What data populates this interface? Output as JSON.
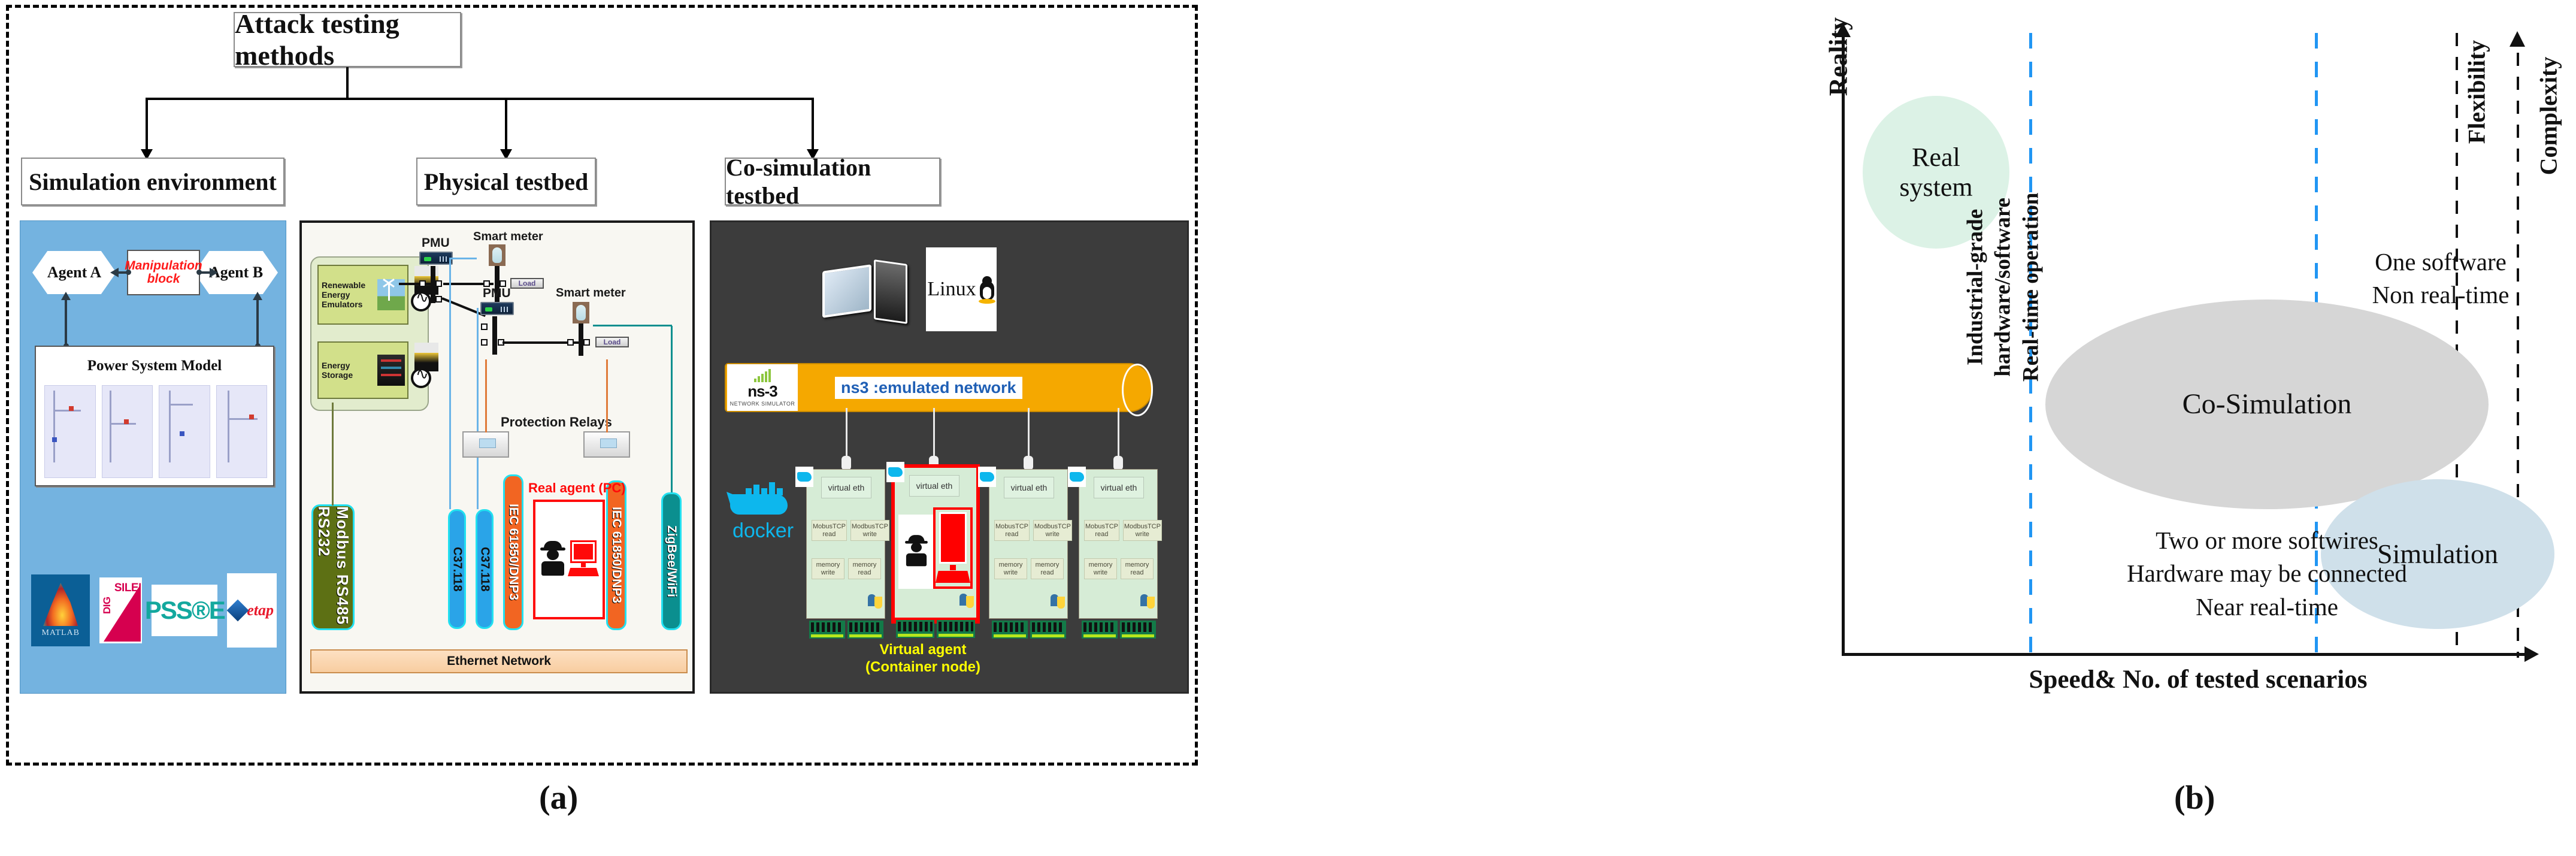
{
  "figure": {
    "caption_a": "(a)",
    "caption_b": "(b)"
  },
  "flowchart": {
    "title": "Attack testing methods",
    "branches": [
      {
        "label": "Simulation environment"
      },
      {
        "label": "Physical testbed"
      },
      {
        "label": "Co-simulation testbed"
      }
    ]
  },
  "simulation_environment": {
    "agent_a": "Agent A",
    "agent_b": "Agent B",
    "manipulation_block_line1": "Manipulation",
    "manipulation_block_line2": "block",
    "power_system_model": "Power System Model",
    "logos": [
      {
        "name": "matlab-logo",
        "text": "MATLAB"
      },
      {
        "name": "digsilent-logo",
        "text_top": "SILENT",
        "text_side": "DIG"
      },
      {
        "name": "psse-logo",
        "text": "PSS®E"
      },
      {
        "name": "etap-logo",
        "text": "etap"
      }
    ]
  },
  "physical_testbed": {
    "renewable_energy_emulators": "Renewable\nEnergy\nEmulators",
    "energy_storage": "Energy\nStorage",
    "pmu_label_1": "PMU",
    "pmu_label_2": "PMU",
    "smart_meter_1": "Smart meter",
    "smart_meter_2": "Smart meter",
    "load_1": "Load",
    "load_2": "Load",
    "protection_relays": "Protection Relays",
    "real_agent": "Real agent (PC)",
    "ethernet_network": "Ethernet Network",
    "protocols": [
      {
        "name": "modbus-rs485-rs232",
        "label": "Modbus RS485 RS232",
        "color": "#5d7014"
      },
      {
        "name": "c37118-a",
        "label": "C37.118",
        "color": "#2aa4e8"
      },
      {
        "name": "c37118-b",
        "label": "C37.118",
        "color": "#2aa4e8"
      },
      {
        "name": "iec61850-dnp3-a",
        "label": "IEC 61850/DNP3",
        "color": "#f26522"
      },
      {
        "name": "iec61850-dnp3-b",
        "label": "IEC 61850/DNP3",
        "color": "#f26522"
      },
      {
        "name": "zigbee-wifi",
        "label": "ZigBee/WiFi",
        "color": "#0b8f8f"
      }
    ]
  },
  "cosimulation_testbed": {
    "linux_label": "Linux",
    "ns3_logo_name": "ns-3",
    "ns3_logo_sub": "NETWORK SIMULATOR",
    "ns3_network_label": "ns3 :emulated network",
    "docker_label": "docker",
    "virtual_agent_line1": "Virtual agent",
    "virtual_agent_line2": "(Container node)",
    "node_labels": {
      "veth": "virtual eth",
      "modbus_read": "MobusTCP read",
      "modbus_write": "ModbusTCP write",
      "memory_write": "memory write",
      "memory_read": "memory read"
    },
    "nodes": [
      {
        "type": "normal"
      },
      {
        "type": "attacker"
      },
      {
        "type": "normal"
      },
      {
        "type": "normal"
      }
    ]
  },
  "chart_data": {
    "type": "scatter",
    "title": "",
    "xlabel": "Speed& No. of tested scenarios",
    "ylabel": "Reality",
    "secondary_axes": [
      {
        "name": "Flexibility",
        "label": "Flexibility",
        "direction": "vertical",
        "style": "dashed"
      },
      {
        "name": "Complexity",
        "label": "Complexity",
        "direction": "up-arrow",
        "style": "dashed"
      }
    ],
    "grid": false,
    "dividers": [
      {
        "x_fraction": 0.27,
        "style": "dashed",
        "color": "#2196f3"
      },
      {
        "x_fraction": 0.69,
        "style": "dashed",
        "color": "#2196f3"
      }
    ],
    "bubbles": [
      {
        "label": "Real system",
        "x_fraction": 0.07,
        "y_fraction": 0.86,
        "size": "small",
        "color": "#dcf2e6"
      },
      {
        "label": "Co-Simulation",
        "x_fraction": 0.45,
        "y_fraction": 0.5,
        "size": "large",
        "color": "#d6d6d6"
      },
      {
        "label": "Simulation",
        "x_fraction": 0.85,
        "y_fraction": 0.22,
        "size": "medium",
        "color": "#cfe0ea"
      }
    ],
    "annotations": [
      {
        "name": "left-region-note",
        "text": "Industrial-grade hardware/software Real-time operation",
        "orientation": "vertical"
      },
      {
        "name": "middle-region-note",
        "text": "Two or more softwires\nHardware may be connected\nNear real-time",
        "orientation": "horizontal"
      },
      {
        "name": "right-region-note",
        "text": "One software\nNon real-time",
        "orientation": "horizontal"
      }
    ]
  },
  "panel_b_text": {
    "y_axis": "Reality",
    "x_axis": "Speed& No. of tested scenarios",
    "flexibility": "Flexibility",
    "complexity": "Complexity",
    "real_system": "Real\nsystem",
    "co_simulation": "Co-Simulation",
    "simulation": "Simulation",
    "left_note": "Industrial-grade\nhardware/software\nReal-time operation",
    "middle_note": "Two or more softwires\nHardware may be connected\nNear real-time",
    "right_note": "One software\nNon real-time"
  }
}
